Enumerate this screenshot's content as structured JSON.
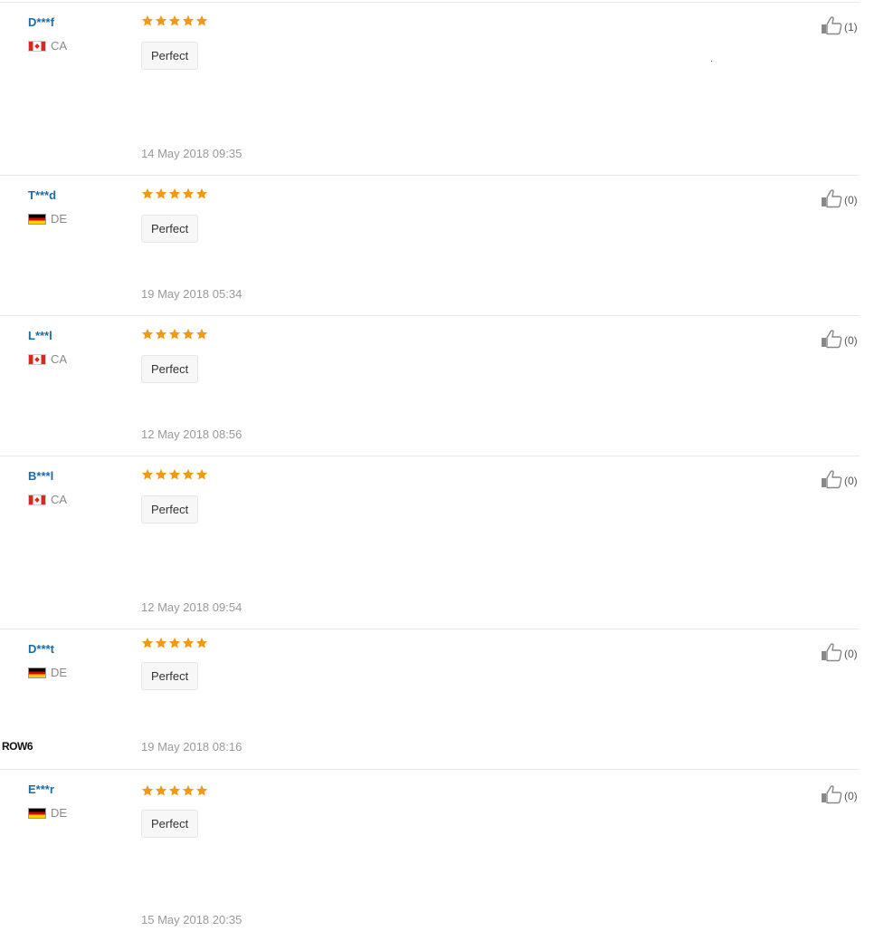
{
  "reviews": [
    {
      "user": "D***f",
      "country": "CA",
      "flag": "ca",
      "rating": 5,
      "tag": "Perfect",
      "date": "14 May 2018 09:35",
      "helpful": "(1)"
    },
    {
      "user": "T***d",
      "country": "DE",
      "flag": "de",
      "rating": 5,
      "tag": "Perfect",
      "date": "19 May 2018 05:34",
      "helpful": "(0)"
    },
    {
      "user": "L***l",
      "country": "CA",
      "flag": "ca",
      "rating": 5,
      "tag": "Perfect",
      "date": "12 May 2018 08:56",
      "helpful": "(0)"
    },
    {
      "user": "B***l",
      "country": "CA",
      "flag": "ca",
      "rating": 5,
      "tag": "Perfect",
      "date": "12 May 2018 09:54",
      "helpful": "(0)"
    },
    {
      "user": "D***t",
      "country": "DE",
      "flag": "de",
      "rating": 5,
      "tag": "Perfect",
      "date": "19 May 2018 08:16",
      "helpful": "(0)"
    },
    {
      "user": "E***r",
      "country": "DE",
      "flag": "de",
      "rating": 5,
      "tag": "Perfect",
      "date": "15 May 2018 20:35",
      "helpful": "(0)"
    }
  ],
  "side_label": "ROW6",
  "colors": {
    "star": "#f09a12",
    "user_link": "#1b6ca8",
    "date": "#999999",
    "thumb": "#888888"
  },
  "icons": {
    "rating": "star-icon",
    "helpful": "thumbs-up-icon",
    "flag_ca": "canada-flag-icon",
    "flag_de": "germany-flag-icon"
  }
}
